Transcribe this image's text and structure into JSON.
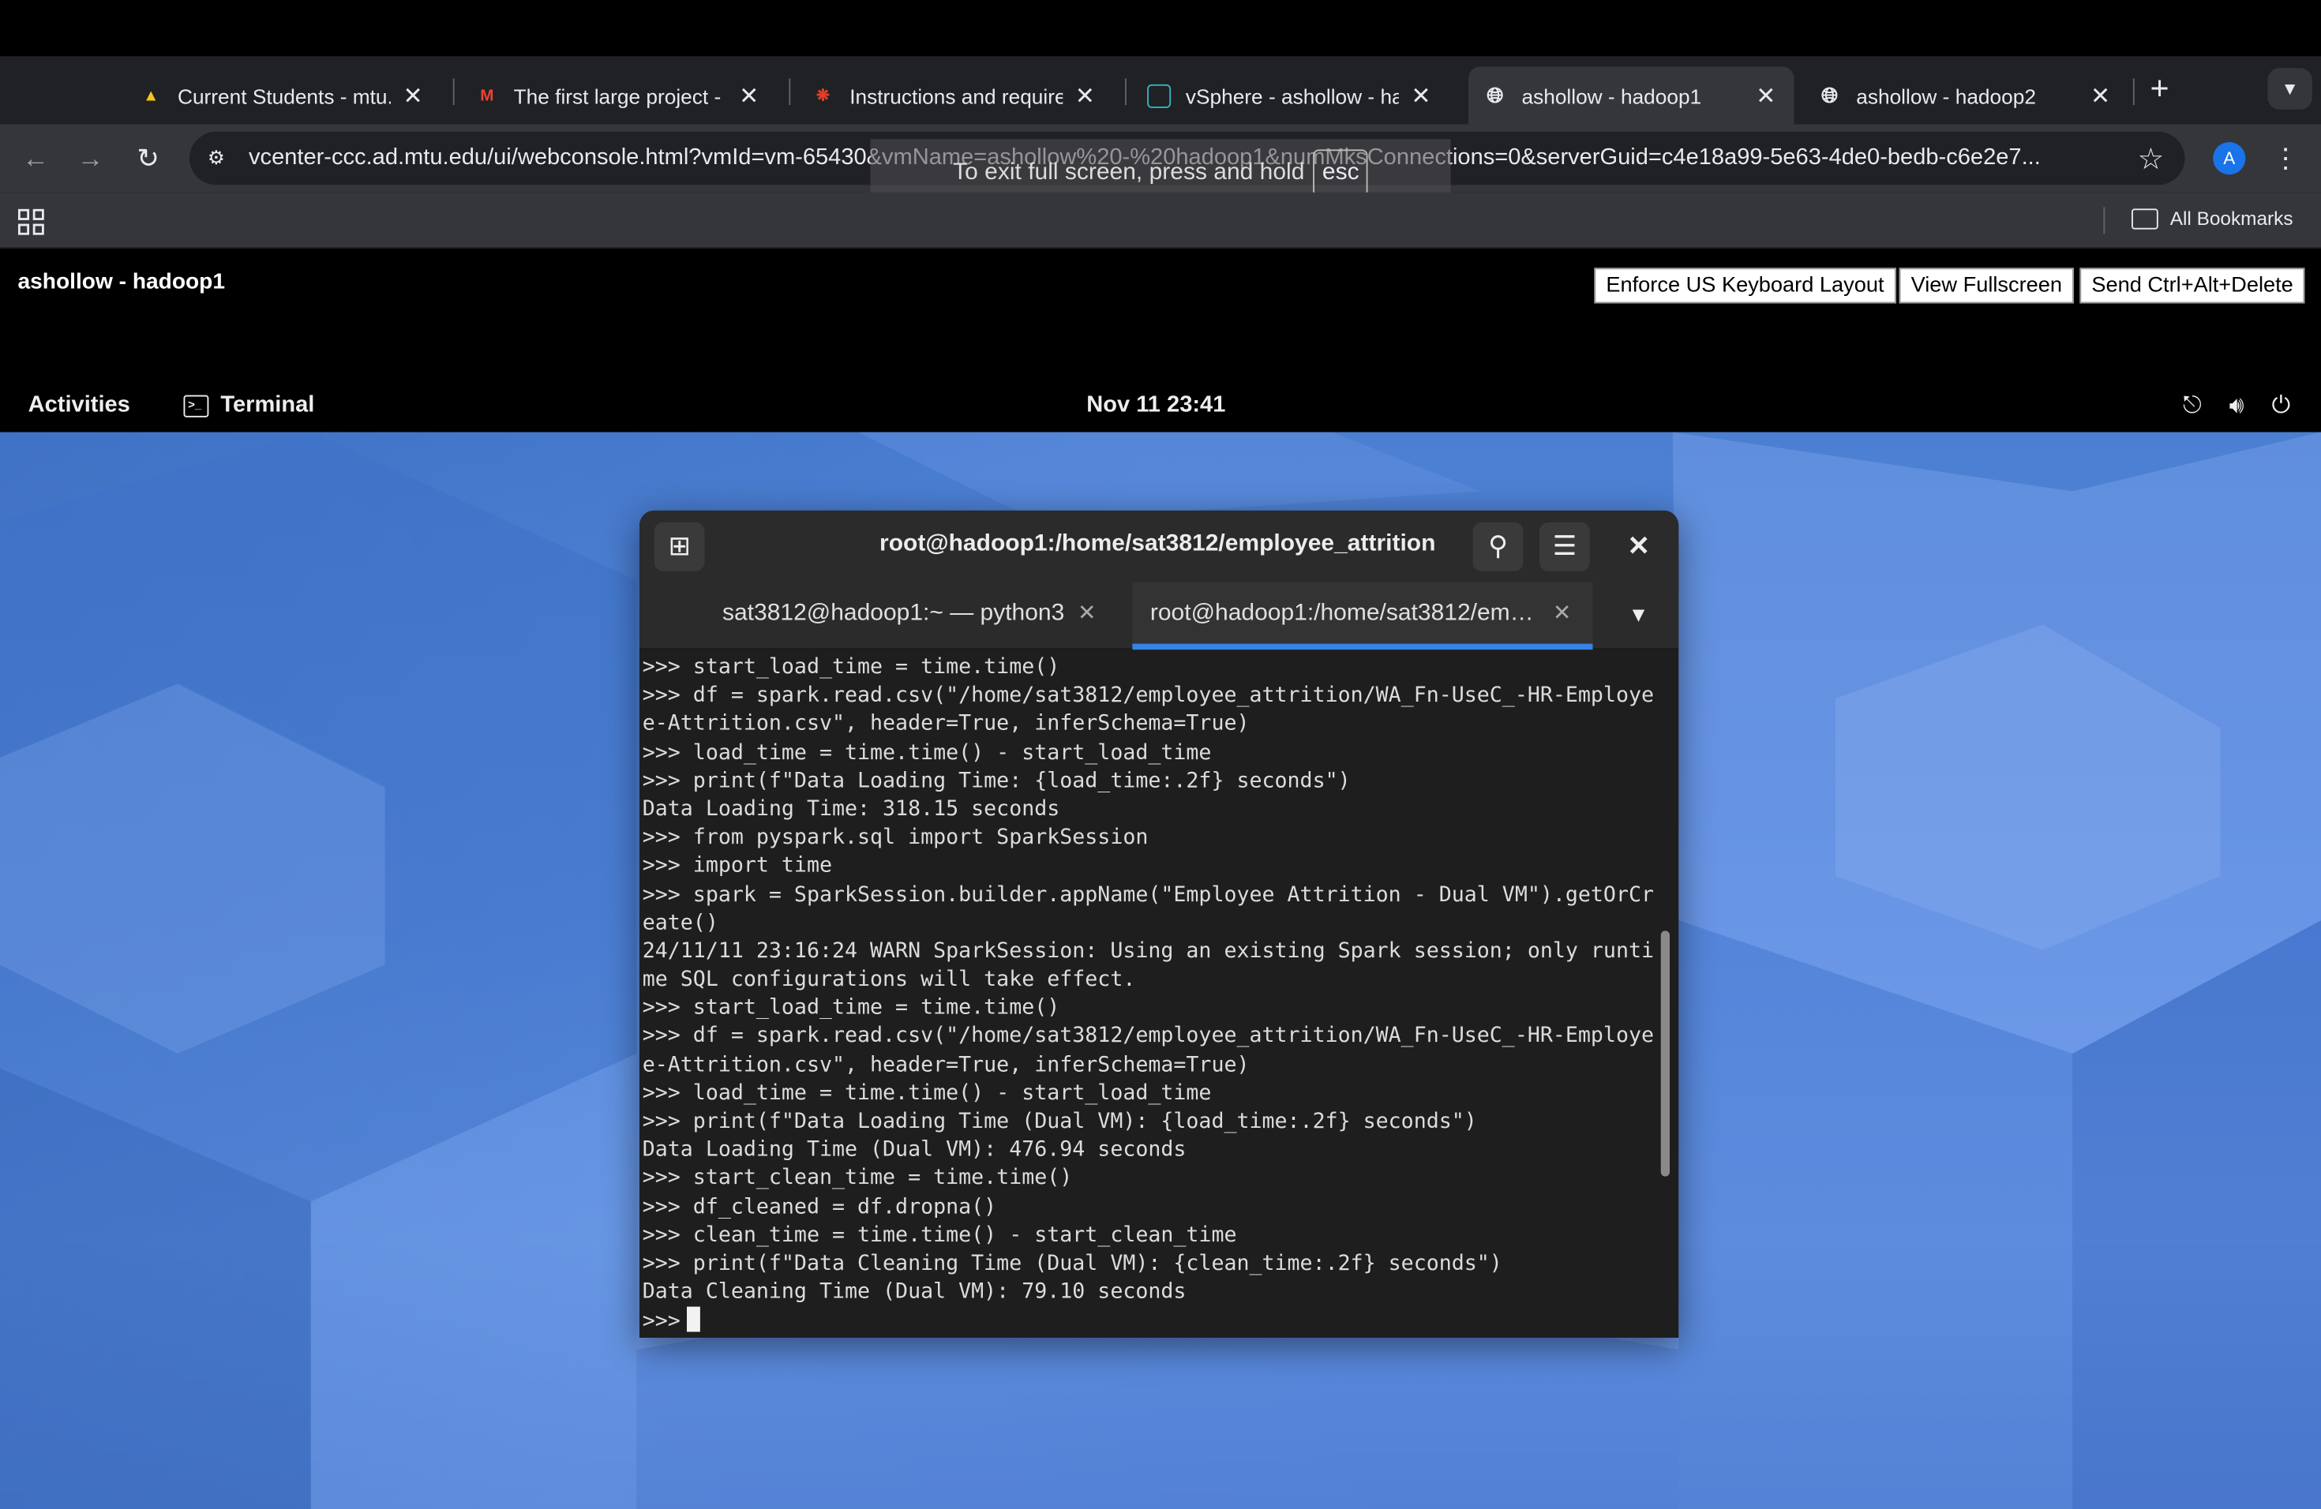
{
  "browser": {
    "tabs": [
      {
        "title": "Current Students - mtu.e",
        "icon": "mtu-favicon",
        "icon_color": "#f5c518"
      },
      {
        "title": "The first large project - a",
        "icon": "gmail-favicon",
        "icon_color": "#ea4335"
      },
      {
        "title": "Instructions and requirem",
        "icon": "canvas-favicon",
        "icon_color": "#e13f2b"
      },
      {
        "title": "vSphere - ashollow - had",
        "icon": "vsphere-favicon",
        "icon_color": "#2fb5c2"
      },
      {
        "title": "ashollow - hadoop1",
        "icon": "globe-favicon",
        "icon_color": "#e8eaed",
        "active": true
      },
      {
        "title": "ashollow - hadoop2",
        "icon": "globe-favicon",
        "icon_color": "#e8eaed"
      }
    ],
    "url": "vcenter-ccc.ad.mtu.edu/ui/webconsole.html?vmId=vm-65430&vmName=ashollow%20-%20hadoop1&numMksConnections=0&serverGuid=c4e18a99-5e63-4de0-bedb-c6e2e7...",
    "fullscreen_notice": "To exit full screen, press and hold",
    "fullscreen_key": "esc",
    "profile_initial": "A",
    "all_bookmarks": "All Bookmarks"
  },
  "console": {
    "vm_title": "ashollow - hadoop1",
    "buttons": {
      "enforce_keyboard": "Enforce US Keyboard Layout",
      "view_fullscreen": "View Fullscreen",
      "ctrl_alt_del": "Send Ctrl+Alt+Delete"
    }
  },
  "gnome": {
    "activities": "Activities",
    "app_name": "Terminal",
    "clock": "Nov 11  23:41"
  },
  "terminal": {
    "title": "root@hadoop1:/home/sat3812/employee_attrition",
    "tabs": [
      {
        "label": "sat3812@hadoop1:~ — python3"
      },
      {
        "label": "root@hadoop1:/home/sat3812/em…",
        "active": true
      }
    ],
    "lines": [
      ">>> start_load_time = time.time()",
      ">>> df = spark.read.csv(\"/home/sat3812/employee_attrition/WA_Fn-UseC_-HR-Employe",
      "e-Attrition.csv\", header=True, inferSchema=True)",
      ">>> load_time = time.time() - start_load_time",
      ">>> print(f\"Data Loading Time: {load_time:.2f} seconds\")",
      "Data Loading Time: 318.15 seconds",
      ">>> from pyspark.sql import SparkSession",
      ">>> import time",
      ">>> spark = SparkSession.builder.appName(\"Employee Attrition - Dual VM\").getOrCr",
      "eate()",
      "24/11/11 23:16:24 WARN SparkSession: Using an existing Spark session; only runti",
      "me SQL configurations will take effect.",
      ">>> start_load_time = time.time()",
      ">>> df = spark.read.csv(\"/home/sat3812/employee_attrition/WA_Fn-UseC_-HR-Employe",
      "e-Attrition.csv\", header=True, inferSchema=True)",
      ">>> load_time = time.time() - start_load_time",
      ">>> print(f\"Data Loading Time (Dual VM): {load_time:.2f} seconds\")",
      "Data Loading Time (Dual VM): 476.94 seconds",
      ">>> start_clean_time = time.time()",
      ">>> df_cleaned = df.dropna()",
      ">>> clean_time = time.time() - start_clean_time",
      ">>> print(f\"Data Cleaning Time (Dual VM): {clean_time:.2f} seconds\")",
      "Data Cleaning Time (Dual VM): 79.10 seconds"
    ],
    "prompt": ">>> ",
    "scroll_position": 0.64
  },
  "colors": {
    "accent": "#3584e4",
    "terminal_bg": "#1e1e1e",
    "chrome_bg": "#202124"
  }
}
